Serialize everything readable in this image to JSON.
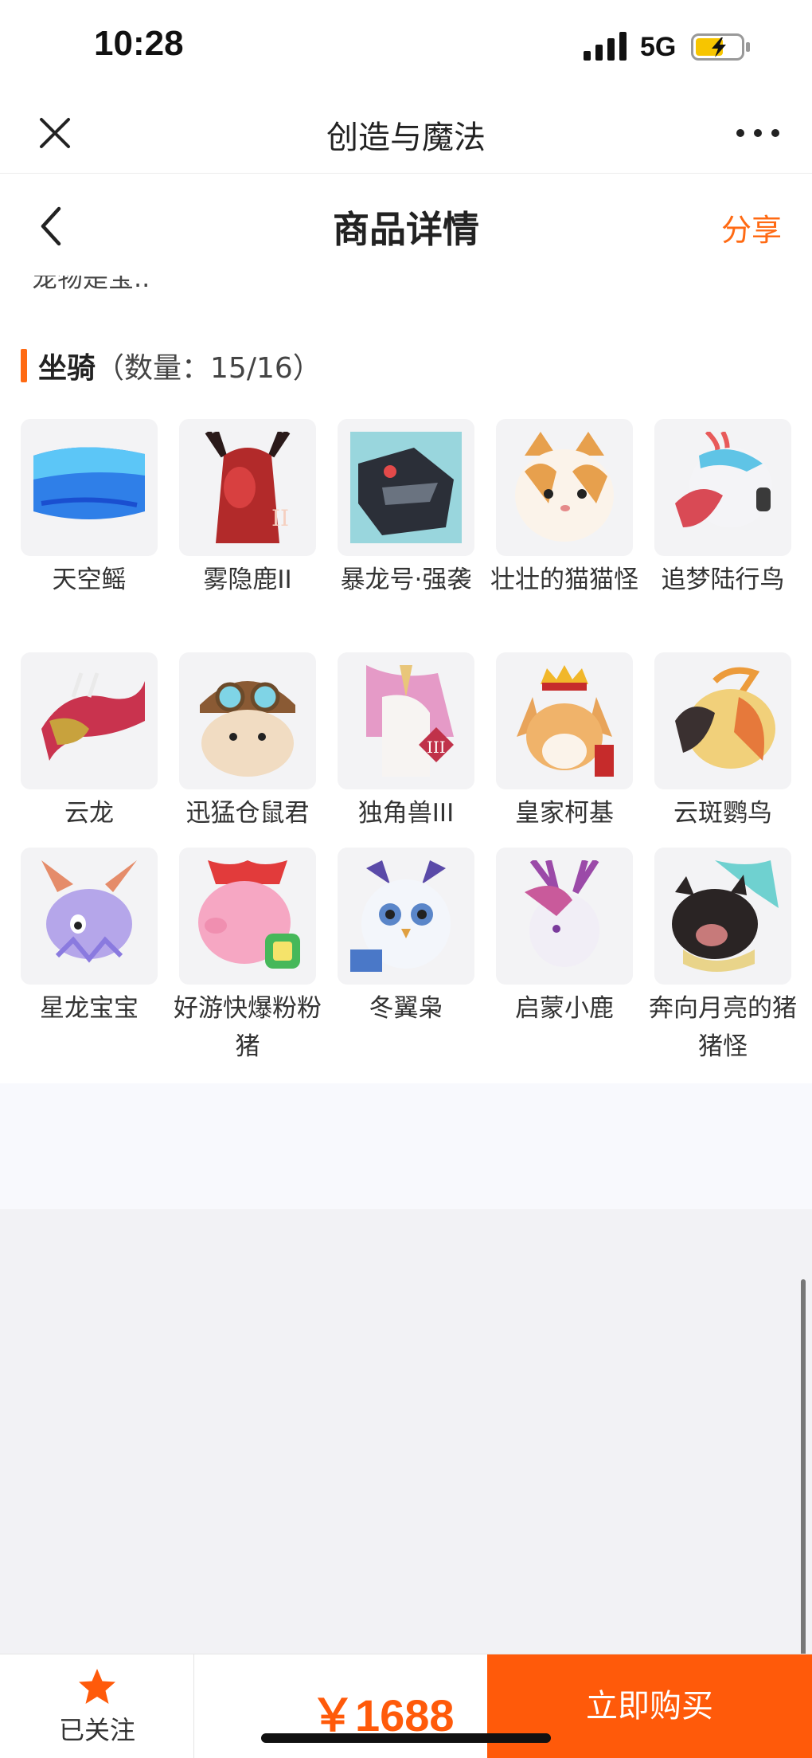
{
  "status_bar": {
    "time": "10:28",
    "network": "5G"
  },
  "app_header": {
    "title": "创造与魔法"
  },
  "page_nav": {
    "title": "商品详情",
    "share_label": "分享"
  },
  "content": {
    "cutoff_text": "宠物是宝..",
    "section": {
      "title": "坐骑",
      "count": "（数量：15/16）"
    },
    "items": [
      {
        "name": "天空鳐"
      },
      {
        "name": "雾隐鹿II"
      },
      {
        "name": "暴龙号·强袭"
      },
      {
        "name": "壮壮的猫猫怪"
      },
      {
        "name": "追梦陆行鸟"
      },
      {
        "name": "云龙"
      },
      {
        "name": "迅猛仓鼠君"
      },
      {
        "name": "独角兽III"
      },
      {
        "name": "皇家柯基"
      },
      {
        "name": "云斑鹦鸟"
      },
      {
        "name": "星龙宝宝"
      },
      {
        "name": "好游快爆粉粉猪"
      },
      {
        "name": "冬翼枭"
      },
      {
        "name": "启蒙小鹿"
      },
      {
        "name": "奔向月亮的猪猪怪"
      }
    ]
  },
  "bottom_bar": {
    "follow_label": "已关注",
    "price": "￥1688",
    "buy_label": "立即购买"
  },
  "colors": {
    "accent": "#ff5a0a",
    "share": "#ff6a13"
  }
}
